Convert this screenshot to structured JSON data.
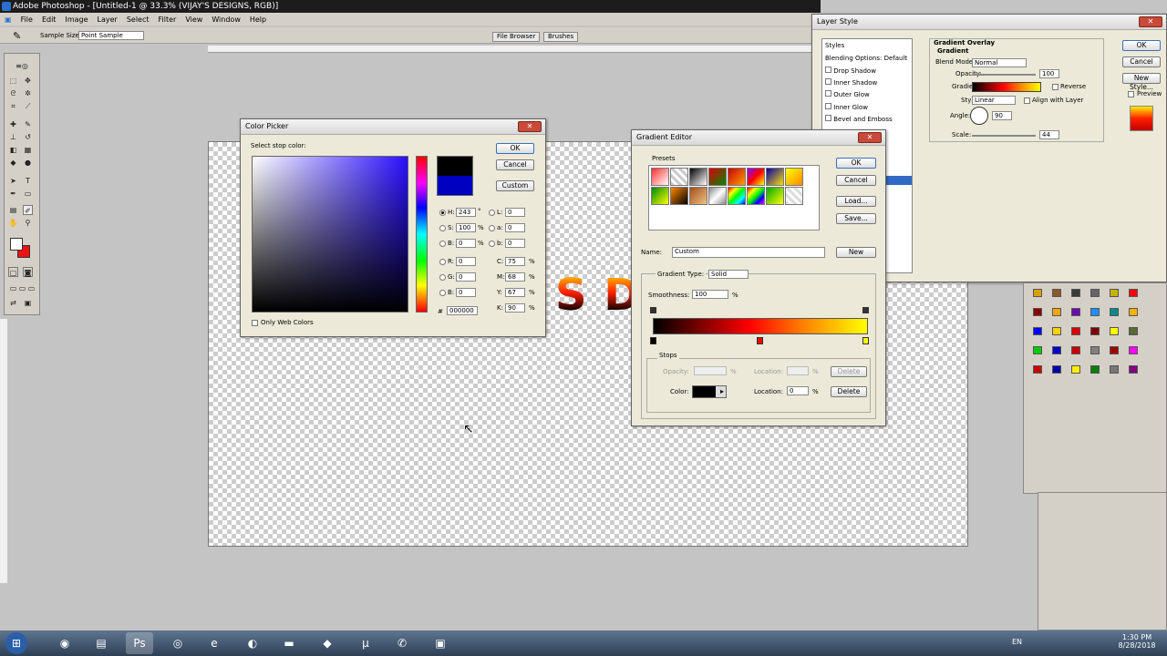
{
  "app": {
    "title": "Adobe Photoshop - [Untitled-1 @ 33.3% (VIJAY'S DESIGNS, RGB)]",
    "menu": [
      "File",
      "Edit",
      "Image",
      "Layer",
      "Select",
      "Filter",
      "View",
      "Window",
      "Help"
    ],
    "options": {
      "sample_size_label": "Sample Size:",
      "sample_size_value": "Point Sample",
      "tab_file_browser": "File Browser",
      "tab_brushes": "Brushes"
    },
    "canvas_text": "S DES"
  },
  "color_picker": {
    "title": "Color Picker",
    "prompt": "Select stop color:",
    "ok": "OK",
    "cancel": "Cancel",
    "custom": "Custom",
    "fields": {
      "H": "243",
      "S": "100",
      "B": "0",
      "R": "0",
      "G": "0",
      "Bl": "0",
      "L": "0",
      "a": "0",
      "b": "0",
      "C": "75",
      "M": "68",
      "Y": "67",
      "K": "90",
      "hex": "000000"
    },
    "units": {
      "deg": "°",
      "pct": "%"
    },
    "only_web": "Only Web Colors",
    "new_color": "#000000",
    "old_color": "#0000c0"
  },
  "gradient_editor": {
    "title": "Gradient Editor",
    "presets_label": "Presets",
    "ok": "OK",
    "cancel": "Cancel",
    "load": "Load...",
    "save": "Save...",
    "name_label": "Name:",
    "name_value": "Custom",
    "new": "New",
    "type_label": "Gradient Type:",
    "type_value": "Solid",
    "smoothness_label": "Smoothness:",
    "smoothness_value": "100",
    "pct": "%",
    "stops_label": "Stops",
    "opacity_label": "Opacity:",
    "location_label": "Location:",
    "delete": "Delete",
    "color_label": "Color:",
    "location_value": "0"
  },
  "layer_style": {
    "title": "Layer Style",
    "styles": [
      "Styles",
      "Blending Options: Default",
      "Drop Shadow",
      "Inner Shadow",
      "Outer Glow",
      "Inner Glow",
      "Bevel and Emboss"
    ],
    "section": "Gradient Overlay",
    "subsection": "Gradient",
    "blend_label": "Blend Mode:",
    "blend_value": "Normal",
    "opacity_label": "Opacity:",
    "opacity_value": "100",
    "gradient_label": "Gradient:",
    "reverse": "Reverse",
    "style_label": "Style:",
    "style_value": "Linear",
    "align": "Align with Layer",
    "angle_label": "Angle:",
    "angle_value": "90",
    "scale_label": "Scale:",
    "scale_value": "44",
    "ok": "OK",
    "cancel": "Cancel",
    "new_style": "New Style...",
    "preview": "Preview"
  },
  "taskbar": {
    "lang": "EN",
    "time": "1:30 PM",
    "date": "8/28/2018"
  },
  "swatches": [
    "#d8a000",
    "#8b5a2b",
    "#3a3a3a",
    "#666666",
    "#c8b400",
    "#ff0000",
    "#8b0000",
    "#ffa500",
    "#6a0dad",
    "#1e90ff",
    "#008b8b",
    "#ffb000",
    "#0000ff",
    "#ffd000",
    "#dd0000",
    "#800000",
    "#ffff00",
    "#556b2f",
    "#00cc00",
    "#0000cc",
    "#cc0000",
    "#808080",
    "#a00000",
    "#ff00ff",
    "#cc0000",
    "#0000aa",
    "#ffee00",
    "#008000",
    "#777777",
    "#800080"
  ]
}
